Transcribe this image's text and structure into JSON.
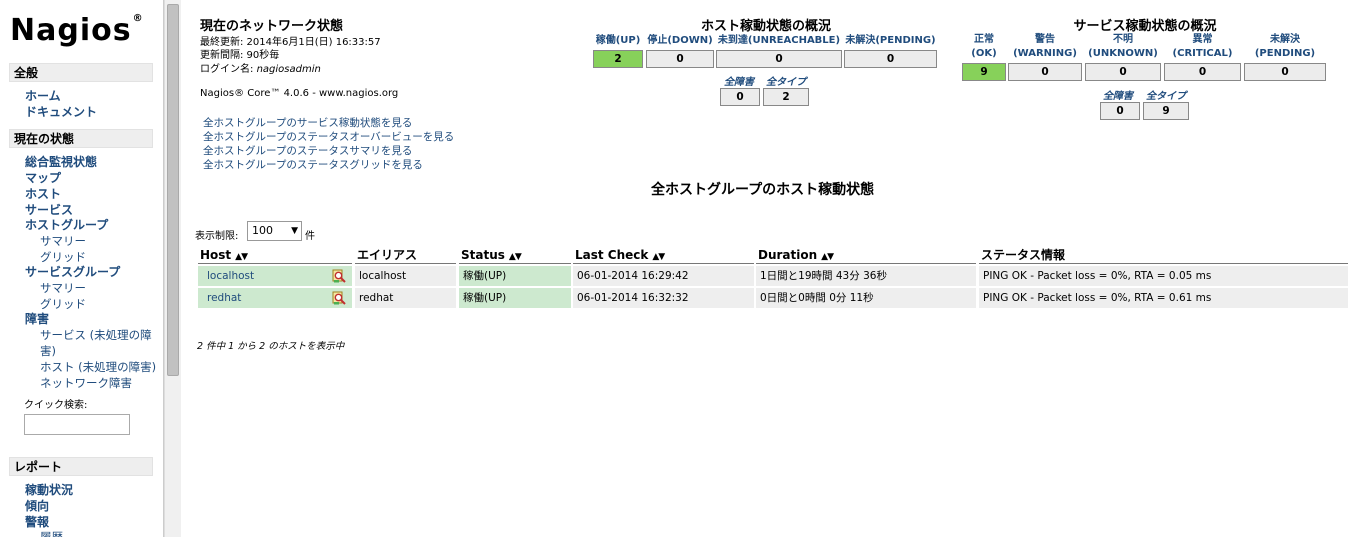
{
  "sidebar": {
    "logo": "Nagios",
    "logo_mark": "®",
    "sections": [
      {
        "title": "全般"
      },
      {
        "title": "現在の状態"
      },
      {
        "title": "レポート"
      }
    ],
    "general": [
      "ホーム",
      "ドキュメント"
    ],
    "current": {
      "tactical": "総合監視状態",
      "map": "マップ",
      "hosts": "ホスト",
      "services": "サービス",
      "hostgroups": "ホストグループ",
      "hg_summary": "サマリー",
      "hg_grid": "グリッド",
      "servicegroups": "サービスグループ",
      "sg_summary": "サマリー",
      "sg_grid": "グリッド",
      "problems": "障害",
      "svc_unhandled_1": "サービス (未処理の障",
      "svc_unhandled_2": "害)",
      "host_unhandled": "ホスト (未処理の障害)",
      "network_outages": "ネットワーク障害",
      "quick_search_label": "クイック検索:",
      "quick_search_value": ""
    },
    "reports": {
      "availability": "稼動状況",
      "trends": "傾向",
      "alerts": "警報",
      "history": "履歴"
    }
  },
  "info": {
    "title": "現在のネットワーク状態",
    "last_updated": "最終更新: 2014年6月1日(日) 16:33:57",
    "update_interval": "更新間隔: 90秒毎",
    "logged_in_prefix": "ログイン名: ",
    "logged_in_user": "nagiosadmin",
    "core_version": "Nagios® Core™ 4.0.6 - www.nagios.org",
    "links": [
      "全ホストグループのサービス稼動状態を見る",
      "全ホストグループのステータスオーバービューを見る",
      "全ホストグループのステータスサマリを見る",
      "全ホストグループのステータスグリッドを見る"
    ]
  },
  "host_summary": {
    "title": "ホスト稼動状態の概況",
    "headers": [
      "稼働(UP)",
      "停止(DOWN)",
      "未到達(UNREACHABLE)",
      "未解決(PENDING)"
    ],
    "values": [
      "2",
      "0",
      "0",
      "0"
    ],
    "sub_headers": [
      "全障害",
      "全タイプ"
    ],
    "sub_values": [
      "0",
      "2"
    ]
  },
  "service_summary": {
    "title": "サービス稼動状態の概況",
    "headers_top": [
      "正常",
      "警告",
      "不明",
      "異常",
      "未解決"
    ],
    "headers_bottom": [
      "(OK)",
      "(WARNING)",
      "(UNKNOWN)",
      "(CRITICAL)",
      "(PENDING)"
    ],
    "values": [
      "9",
      "0",
      "0",
      "0",
      "0"
    ],
    "sub_headers": [
      "全障害",
      "全タイプ"
    ],
    "sub_values": [
      "0",
      "9"
    ]
  },
  "page_title": "全ホストグループのホスト稼動状態",
  "limit": {
    "label": "表示制限:",
    "value": "100",
    "unit": "件"
  },
  "table": {
    "columns": [
      "Host",
      "エイリアス",
      "Status",
      "Last Check",
      "Duration",
      "ステータス情報"
    ],
    "rows": [
      {
        "host": "localhost",
        "alias": "localhost",
        "status": "稼働(UP)",
        "last_check": "06-01-2014 16:29:42",
        "duration": "1日間と19時間 43分 36秒",
        "info": "PING OK - Packet loss = 0%, RTA = 0.05 ms"
      },
      {
        "host": "redhat",
        "alias": "redhat",
        "status": "稼働(UP)",
        "last_check": "06-01-2014 16:32:32",
        "duration": "0日間と0時間 0分 11秒",
        "info": "PING OK - Packet loss = 0%, RTA = 0.61 ms"
      }
    ]
  },
  "footer_note": "2 件中 1 から 2 のホストを表示中",
  "colors": {
    "up_green": "#87d15a",
    "row_green": "#cde9cf",
    "link_blue": "#204c7d"
  }
}
